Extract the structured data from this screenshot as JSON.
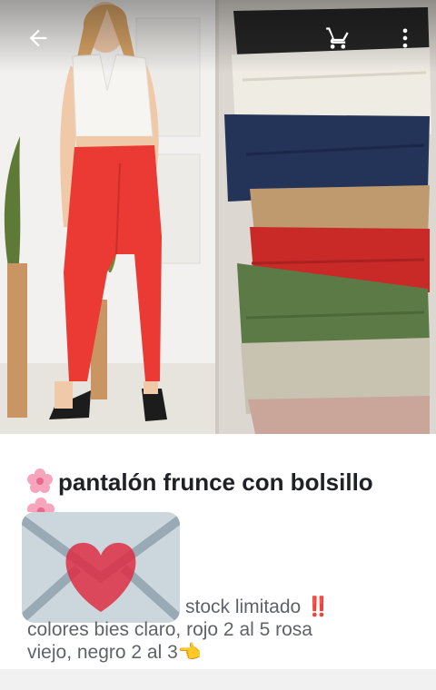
{
  "toolbar": {
    "back_icon": "arrow-left-icon",
    "cart_icon": "shopping-cart-icon",
    "menu_icon": "more-vertical-icon"
  },
  "product": {
    "title": "pantalón frunce con bolsillo",
    "desc_line1": "stock limitado ‼️",
    "desc_line2": "colores bies claro, rojo 2 al 5  rosa",
    "desc_line3": "viejo, negro 2 al 3👈"
  },
  "colors": {
    "pants_red": "#ea3a33",
    "stack": [
      "#262626",
      "#efece4",
      "#243358",
      "#bf9a6e",
      "#c92a28",
      "#5c7a45",
      "#c8c2b0",
      "#c9a59a"
    ]
  }
}
